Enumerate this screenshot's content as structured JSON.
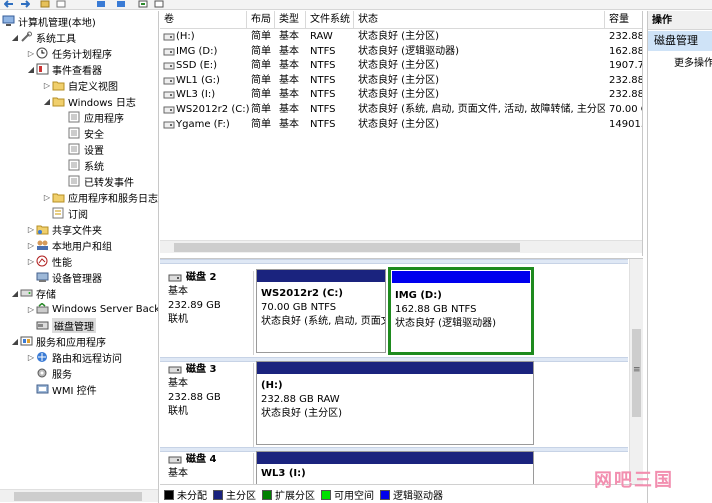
{
  "tree": {
    "items": [
      {
        "label": "计算机管理(本地)",
        "icon": "computer-management-icon"
      },
      {
        "label": "系统工具",
        "icon": "system-tools-icon"
      },
      {
        "label": "任务计划程序",
        "icon": "clock-icon"
      },
      {
        "label": "事件查看器",
        "icon": "event-viewer-icon"
      },
      {
        "label": "自定义视图",
        "icon": "folder-icon"
      },
      {
        "label": "Windows 日志",
        "icon": "folder-icon"
      },
      {
        "label": "应用程序",
        "icon": "log-icon"
      },
      {
        "label": "安全",
        "icon": "log-icon"
      },
      {
        "label": "设置",
        "icon": "log-icon"
      },
      {
        "label": "系统",
        "icon": "log-icon"
      },
      {
        "label": "已转发事件",
        "icon": "log-icon"
      },
      {
        "label": "应用程序和服务日志",
        "icon": "folder-icon"
      },
      {
        "label": "订阅",
        "icon": "subscription-icon"
      },
      {
        "label": "共享文件夹",
        "icon": "shared-folder-icon"
      },
      {
        "label": "本地用户和组",
        "icon": "users-icon"
      },
      {
        "label": "性能",
        "icon": "performance-icon"
      },
      {
        "label": "设备管理器",
        "icon": "device-manager-icon"
      },
      {
        "label": "存储",
        "icon": "storage-icon"
      },
      {
        "label": "Windows Server Back",
        "icon": "backup-icon"
      },
      {
        "label": "磁盘管理",
        "icon": "disk-management-icon"
      },
      {
        "label": "服务和应用程序",
        "icon": "services-apps-icon"
      },
      {
        "label": "路由和远程访问",
        "icon": "routing-icon"
      },
      {
        "label": "服务",
        "icon": "services-icon"
      },
      {
        "label": "WMI 控件",
        "icon": "wmi-icon"
      }
    ]
  },
  "volumes": {
    "columns": [
      "卷",
      "布局",
      "类型",
      "文件系统",
      "状态",
      "容量"
    ],
    "rows": [
      {
        "volume": "(H:)",
        "layout": "简单",
        "type": "基本",
        "fs": "RAW",
        "status": "状态良好 (主分区)",
        "capacity": "232.88"
      },
      {
        "volume": "IMG (D:)",
        "layout": "简单",
        "type": "基本",
        "fs": "NTFS",
        "status": "状态良好 (逻辑驱动器)",
        "capacity": "162.88"
      },
      {
        "volume": "SSD (E:)",
        "layout": "简单",
        "type": "基本",
        "fs": "NTFS",
        "status": "状态良好 (主分区)",
        "capacity": "1907.7"
      },
      {
        "volume": "WL1 (G:)",
        "layout": "简单",
        "type": "基本",
        "fs": "NTFS",
        "status": "状态良好 (主分区)",
        "capacity": "232.88"
      },
      {
        "volume": "WL3 (I:)",
        "layout": "简单",
        "type": "基本",
        "fs": "NTFS",
        "status": "状态良好 (主分区)",
        "capacity": "232.88"
      },
      {
        "volume": "WS2012r2 (C:)",
        "layout": "简单",
        "type": "基本",
        "fs": "NTFS",
        "status": "状态良好 (系统, 启动, 页面文件, 活动, 故障转储, 主分区)",
        "capacity": "70.00 C"
      },
      {
        "volume": "Ygame (F:)",
        "layout": "简单",
        "type": "基本",
        "fs": "NTFS",
        "status": "状态良好 (主分区)",
        "capacity": "14901."
      }
    ]
  },
  "disks": [
    {
      "name": "磁盘 2",
      "type": "基本",
      "size": "232.89 GB",
      "status": "联机",
      "partitions": [
        {
          "title": "WS2012r2  (C:)",
          "size": "70.00 GB NTFS",
          "status": "状态良好 (系统, 启动, 页面文",
          "bar": "#1a237e"
        },
        {
          "title": "IMG  (D:)",
          "size": "162.88 GB NTFS",
          "status": "状态良好 (逻辑驱动器)",
          "bar": "#0000ee"
        }
      ]
    },
    {
      "name": "磁盘 3",
      "type": "基本",
      "size": "232.88 GB",
      "status": "联机",
      "partitions": [
        {
          "title": "(H:)",
          "size": "232.88 GB RAW",
          "status": "状态良好 (主分区)",
          "bar": "#1a237e"
        }
      ]
    },
    {
      "name": "磁盘 4",
      "type": "基本",
      "size": "",
      "status": "",
      "partitions": [
        {
          "title": "WL3  (I:)",
          "size": "",
          "status": "",
          "bar": "#1a237e"
        }
      ]
    }
  ],
  "legend": [
    {
      "label": "未分配",
      "color": "#000000"
    },
    {
      "label": "主分区",
      "color": "#1a237e"
    },
    {
      "label": "扩展分区",
      "color": "#008000"
    },
    {
      "label": "可用空间",
      "color": "#00e000"
    },
    {
      "label": "逻辑驱动器",
      "color": "#0000ee"
    }
  ],
  "actions": {
    "header": "操作",
    "section": "磁盘管理",
    "item": "更多操作"
  },
  "watermark": "网吧三国",
  "colors": {
    "selection_border": "#1e8a1e",
    "primary_partition": "#1a237e",
    "logical_drive": "#0000ee",
    "action_section_bg": "#cfe3f7"
  }
}
